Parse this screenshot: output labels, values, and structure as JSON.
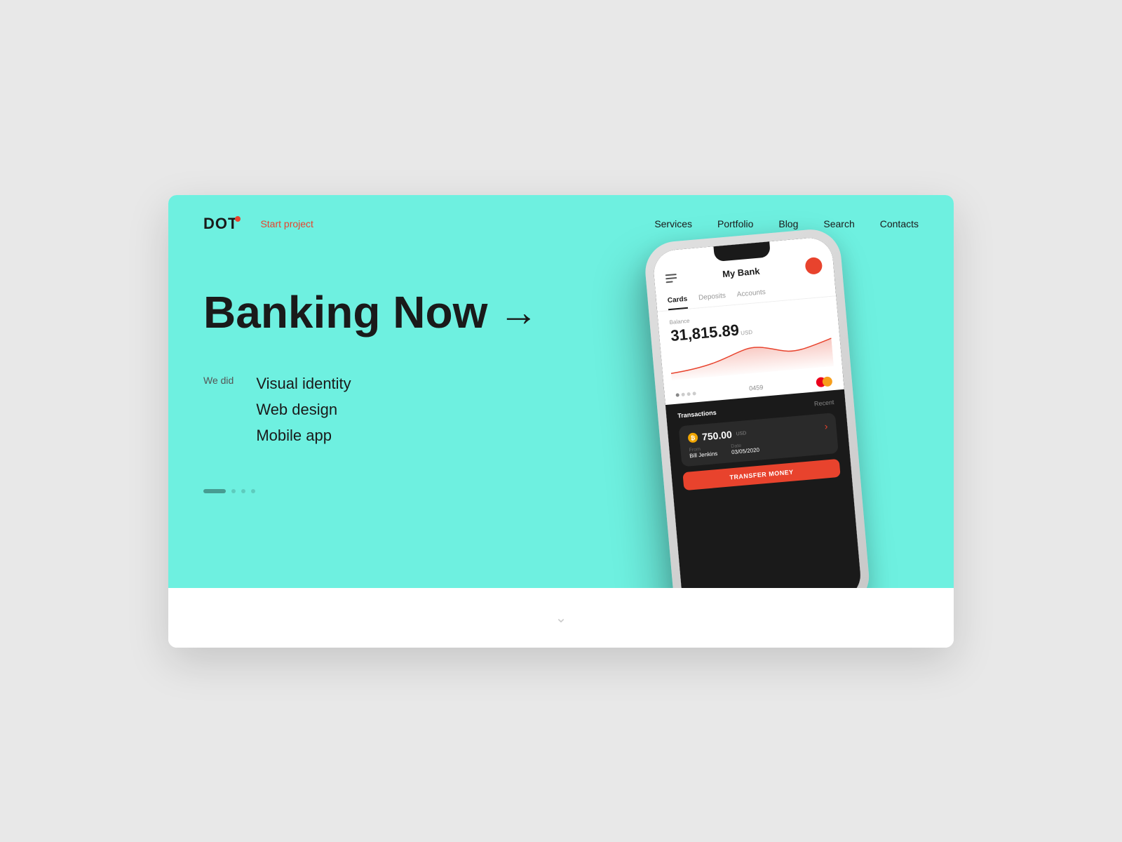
{
  "logo": {
    "text": "DOT"
  },
  "nav": {
    "start_project": "Start project",
    "links": [
      {
        "label": "Services",
        "id": "services"
      },
      {
        "label": "Portfolio",
        "id": "portfolio"
      },
      {
        "label": "Blog",
        "id": "blog"
      },
      {
        "label": "Search",
        "id": "search"
      },
      {
        "label": "Contacts",
        "id": "contacts"
      }
    ]
  },
  "hero": {
    "title": "Banking Now",
    "title_arrow": "→",
    "we_did_label": "We did",
    "services": [
      "Visual identity",
      "Web design",
      "Mobile app"
    ]
  },
  "phone_app": {
    "title": "My Bank",
    "tabs": [
      "Cards",
      "Deposits",
      "Accounts"
    ],
    "active_tab": "Cards",
    "balance_label": "Balance",
    "balance_amount": "31,815.89",
    "balance_currency": "USD",
    "card_number": "0459",
    "transactions_title": "Transactions",
    "transactions_recent": "Recent",
    "transaction": {
      "amount": "750.00",
      "currency": "USD",
      "from_label": "From",
      "from_value": "Bill Jenkins",
      "date_label": "Date",
      "date_value": "03/05/2020"
    },
    "transfer_button": "TRANSFER MONEY"
  },
  "dots": [
    {
      "active": true
    },
    {
      "active": false
    },
    {
      "active": false
    },
    {
      "active": false
    }
  ],
  "colors": {
    "hero_bg": "#6ef0e0",
    "accent": "#e8432d",
    "dark": "#1a1a1a",
    "text_muted": "#999"
  }
}
